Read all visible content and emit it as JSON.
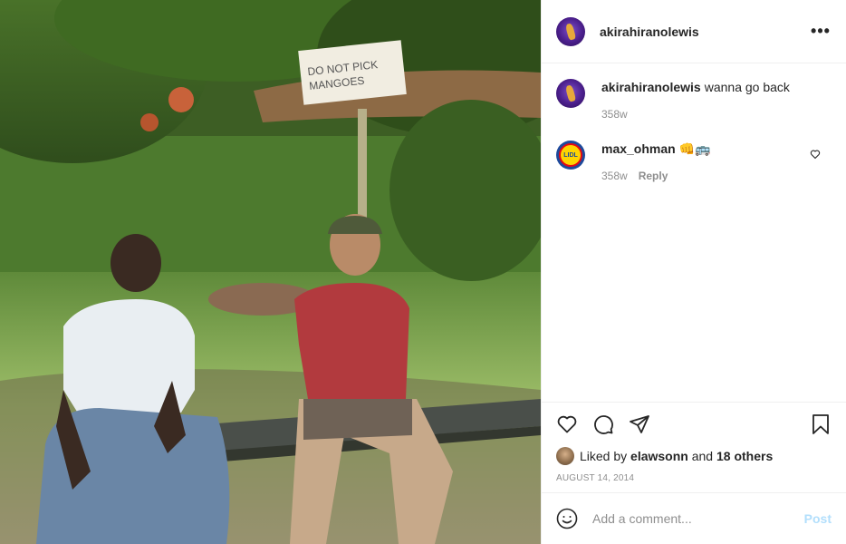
{
  "post": {
    "author": "akirahiranolewis",
    "sign_text": "DO NOT PICK MANGOES"
  },
  "comments": [
    {
      "username": "akirahiranolewis",
      "text": "wanna go back",
      "age": "358w",
      "reply": ""
    },
    {
      "username": "max_ohman",
      "text": "👊🚌",
      "age": "358w",
      "reply": "Reply"
    }
  ],
  "lidl_logo": "LIDL",
  "likes": {
    "prefix": "Liked by",
    "user": "elawsonn",
    "middle": "and",
    "others": "18 others"
  },
  "date": "AUGUST 14, 2014",
  "add_comment": {
    "placeholder": "Add a comment...",
    "post_label": "Post"
  },
  "icons": [
    "more-icon",
    "heart-icon",
    "comment-icon",
    "share-icon",
    "bookmark-icon",
    "emoji-icon"
  ],
  "colors": {
    "post_button": "#b2dffc",
    "meta_text": "#8e8e8e",
    "text": "#262626",
    "divider": "#efefef"
  }
}
